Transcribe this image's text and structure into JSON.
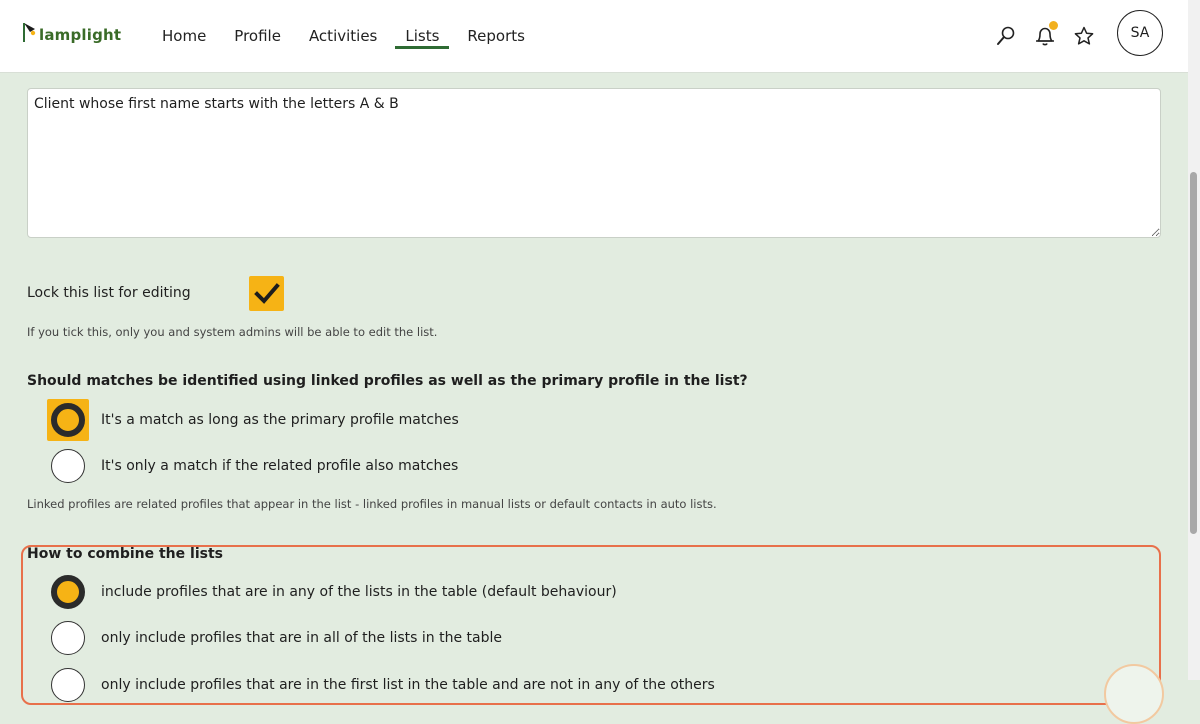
{
  "app": {
    "logo_text": "lamplight",
    "brand_color": "#2e6b33",
    "accent_color": "#f6b315"
  },
  "nav": {
    "items": [
      {
        "label": "Home"
      },
      {
        "label": "Profile"
      },
      {
        "label": "Activities"
      },
      {
        "label": "Lists",
        "active": true
      },
      {
        "label": "Reports"
      }
    ]
  },
  "header_icons": {
    "search": "search-icon",
    "notifications": "bell-icon",
    "favourites": "star-icon"
  },
  "user": {
    "initials": "SA"
  },
  "form": {
    "description_value": "Client whose first name starts with the letters A & B",
    "lock": {
      "label": "Lock this list for editing",
      "checked": true,
      "help": "If you tick this, only you and system admins will be able to edit the list."
    },
    "linked": {
      "question": "Should matches be identified using linked profiles as well as the primary profile in the list?",
      "options": [
        {
          "label": "It's a match as long as the primary profile matches",
          "selected": true
        },
        {
          "label": "It's only a match if the related profile also matches",
          "selected": false
        }
      ],
      "help": "Linked profiles are related profiles that appear in the list - linked profiles in manual lists or default contacts in auto lists."
    },
    "combine": {
      "title": "How to combine the lists",
      "options": [
        {
          "label": "include profiles that are in any of the lists in the table (default behaviour)",
          "selected": true
        },
        {
          "label": "only include profiles that are in all of the lists in the table",
          "selected": false
        },
        {
          "label": "only include profiles that are in the first list in the table and are not in any of the others",
          "selected": false
        }
      ]
    }
  }
}
